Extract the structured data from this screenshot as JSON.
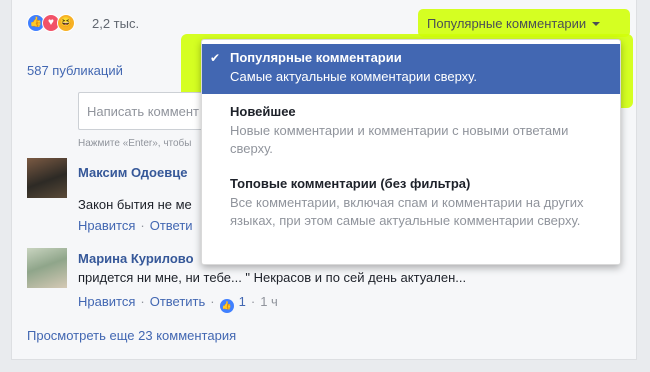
{
  "reactions": {
    "count": "2,2 тыс.",
    "icons": [
      "like-icon",
      "love-icon",
      "haha-icon"
    ],
    "glyphs": {
      "like": "👍",
      "love": "♥",
      "haha": "😆"
    }
  },
  "sort": {
    "label": "Популярные комментарии",
    "highlight_color": "#d2ff0a"
  },
  "publications": "587 публикаций",
  "comment_input": {
    "placeholder": "Написать коммент",
    "hint": "Нажмите «Enter», чтобы"
  },
  "comments": [
    {
      "author": "Максим Одоевце",
      "text": "Закон бытия не ме",
      "like": "Нравится",
      "reply": "Ответи"
    },
    {
      "author": "Марина Курилово",
      "text": "придется ни мне, ни тебе... \" Некрасов и по сей день актуален...",
      "like": "Нравится",
      "reply": "Ответить",
      "likes_count": "1",
      "time": "1 ч"
    }
  ],
  "more_comments": "Просмотреть еще 23 комментария",
  "dropdown": {
    "check": "✔",
    "options": [
      {
        "title": "Популярные комментарии",
        "desc": "Самые актуальные комментарии сверху."
      },
      {
        "title": "Новейшее",
        "desc": "Новые комментарии и комментарии с новыми ответами сверху."
      },
      {
        "title": "Топовые комментарии (без фильтра)",
        "desc": "Все комментарии, включая спам и комментарии на других языках, при этом самые актуальные комментарии сверху."
      }
    ]
  },
  "colors": {
    "link": "#4267b2",
    "selected_bg": "#4267b2",
    "author": "#365899"
  }
}
